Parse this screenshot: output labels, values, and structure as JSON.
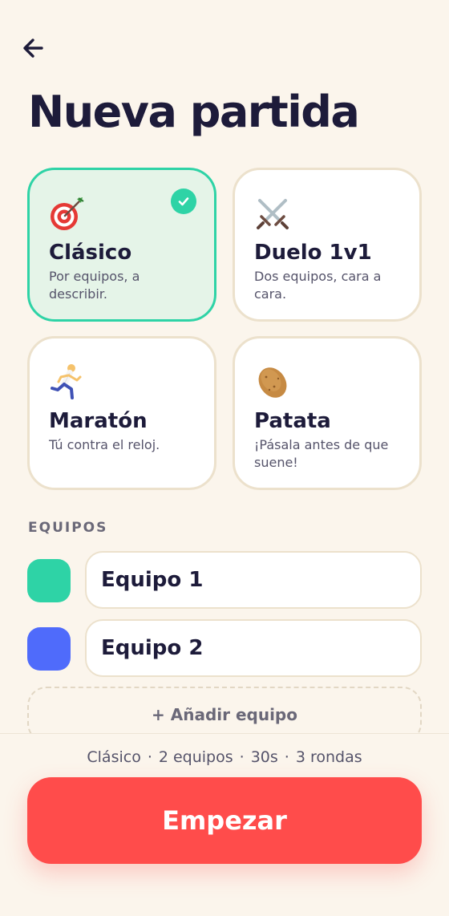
{
  "title": "Nueva partida",
  "icons": {
    "back": "arrow-left-icon",
    "check": "check-icon"
  },
  "modes": [
    {
      "icon": "target-icon",
      "name": "Clásico",
      "description": "Por equipos, a describir.",
      "selected": true
    },
    {
      "icon": "crossed-swords-icon",
      "name": "Duelo 1v1",
      "description": "Dos equipos, cara a cara.",
      "selected": false
    },
    {
      "icon": "runner-icon",
      "name": "Maratón",
      "description": "Tú contra el reloj.",
      "selected": false
    },
    {
      "icon": "potato-icon",
      "name": "Patata",
      "description": "¡Pásala antes de que suene!",
      "selected": false
    }
  ],
  "teams_section": {
    "label": "EQUIPOS",
    "teams": [
      {
        "name": "Equipo 1",
        "color": "#2ED3A6"
      },
      {
        "name": "Equipo 2",
        "color": "#4F6BFB"
      }
    ],
    "add_label": "+ Añadir equipo"
  },
  "summary": {
    "mode": "Clásico",
    "teams": "2 equipos",
    "time": "30s",
    "rounds": "3 rondas",
    "separator": "·"
  },
  "start_label": "Empezar",
  "colors": {
    "background": "#FBF5EC",
    "accent_selected": "#2ED3A6",
    "start_button": "#FF4C4B",
    "text_primary": "#1D1B3A"
  }
}
